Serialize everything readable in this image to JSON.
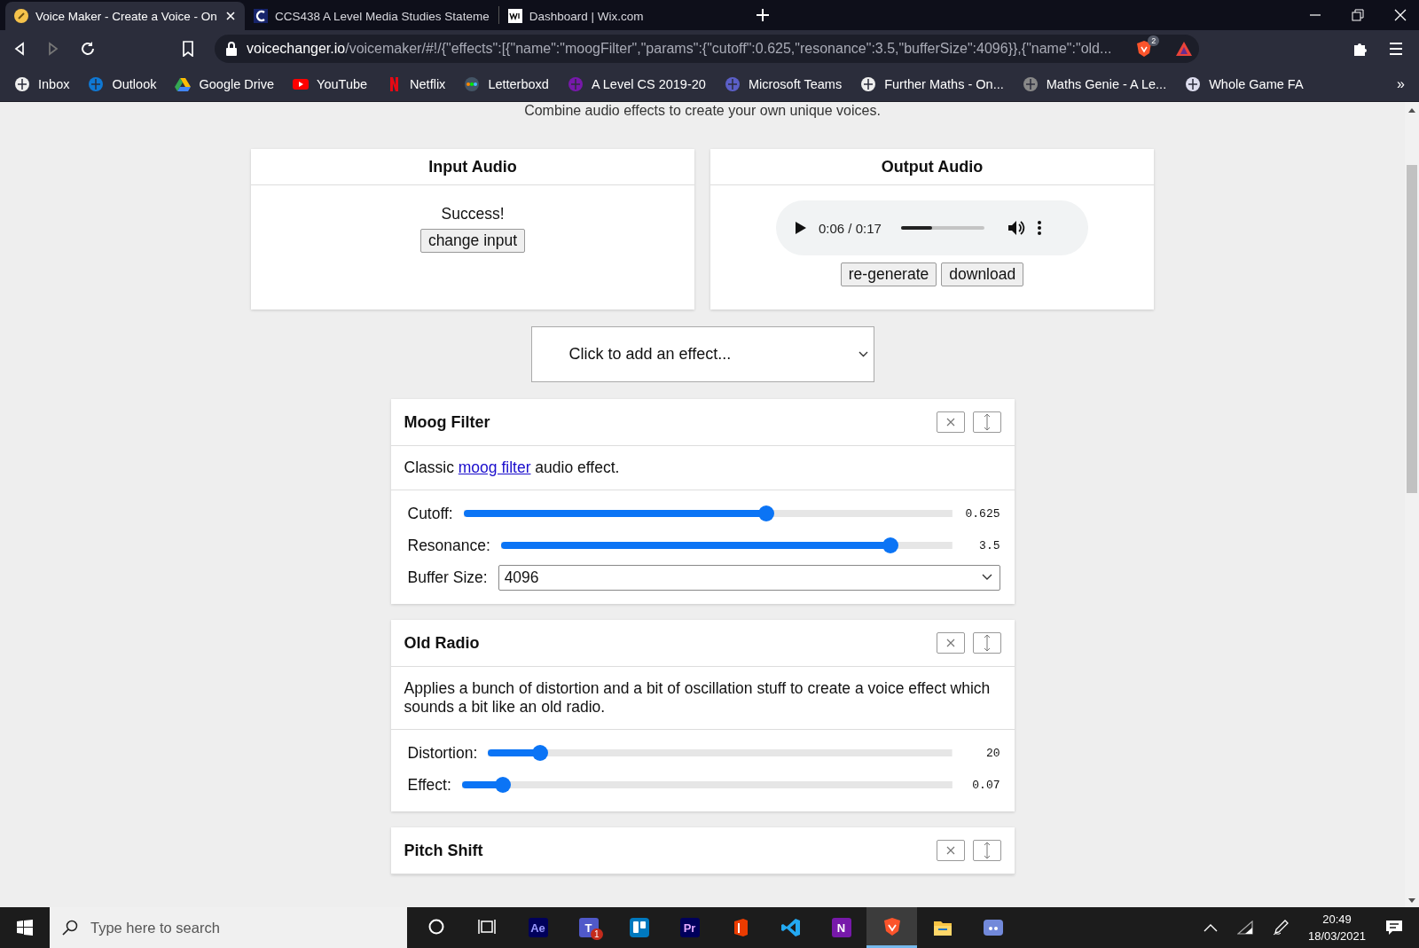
{
  "browser": {
    "tabs": [
      {
        "title": "Voice Maker - Create a Voice - On",
        "selected": true
      },
      {
        "title": "CCS438 A Level Media Studies Stateme",
        "selected": false
      },
      {
        "title": "Dashboard | Wix.com",
        "selected": false
      }
    ],
    "address": {
      "domain": "voicechanger.io",
      "path": "/voicemaker/#!/{\"effects\":[{\"name\":\"moogFilter\",\"params\":{\"cutoff\":0.625,\"resonance\":3.5,\"bufferSize\":4096}},{\"name\":\"old..."
    },
    "shields_count": "2",
    "bookmarks": [
      {
        "label": "Inbox"
      },
      {
        "label": "Outlook"
      },
      {
        "label": "Google Drive"
      },
      {
        "label": "YouTube"
      },
      {
        "label": "Netflix"
      },
      {
        "label": "Letterboxd"
      },
      {
        "label": "A Level CS 2019-20"
      },
      {
        "label": "Microsoft Teams"
      },
      {
        "label": "Further Maths - On..."
      },
      {
        "label": "Maths Genie - A Le..."
      },
      {
        "label": "Whole Game FA"
      }
    ],
    "more_bookmarks": "»"
  },
  "page": {
    "tagline": "Combine audio effects to create your own unique voices.",
    "input_audio": {
      "title": "Input Audio",
      "status": "Success!",
      "button": "change input"
    },
    "output_audio": {
      "title": "Output Audio",
      "time": "0:06 / 0:17",
      "level": 0.37,
      "buttons": [
        "re-generate",
        "download"
      ]
    },
    "effect_select": {
      "placeholder": "Click to add an effect..."
    },
    "effects": [
      {
        "title": "Moog Filter",
        "description": [
          {
            "text": "Classic ",
            "link": false
          },
          {
            "text": "moog filter",
            "link": true
          },
          {
            "text": " audio effect.",
            "link": false
          }
        ],
        "params": [
          {
            "kind": "slider",
            "label": "Cutoff:",
            "level": 0.62,
            "reading": "0.625"
          },
          {
            "kind": "slider",
            "label": "Resonance:",
            "level": 0.863,
            "reading": "3.5"
          },
          {
            "kind": "select",
            "label": "Buffer Size:",
            "value": "4096"
          }
        ]
      },
      {
        "title": "Old Radio",
        "description": [
          {
            "text": "Applies a bunch of distortion and a bit of oscillation stuff to create a voice effect which sounds a bit like an old radio.",
            "link": false
          }
        ],
        "params": [
          {
            "kind": "slider",
            "label": "Distortion:",
            "level": 0.113,
            "reading": "20"
          },
          {
            "kind": "slider",
            "label": "Effect:",
            "level": 0.083,
            "reading": "0.07"
          }
        ]
      },
      {
        "title": "Pitch Shift"
      }
    ]
  },
  "taskbar": {
    "search": {
      "placeholder": "Type here to search"
    },
    "apps": [
      {
        "kind": "cortana",
        "selected": false
      },
      {
        "kind": "taskview",
        "selected": false
      },
      {
        "kind": "ae",
        "label": "Ae",
        "selected": false
      },
      {
        "kind": "teams",
        "label": "T",
        "badge": "1",
        "selected": false
      },
      {
        "kind": "trello",
        "selected": false
      },
      {
        "kind": "pr",
        "label": "Pr",
        "selected": false
      },
      {
        "kind": "office",
        "selected": false
      },
      {
        "kind": "vscode",
        "selected": false
      },
      {
        "kind": "onenote",
        "label": "N",
        "selected": false
      },
      {
        "kind": "brave",
        "selected": true
      },
      {
        "kind": "explorer",
        "selected": false
      },
      {
        "kind": "discord",
        "selected": false
      }
    ],
    "time": "20:49",
    "date": "18/03/2021"
  }
}
